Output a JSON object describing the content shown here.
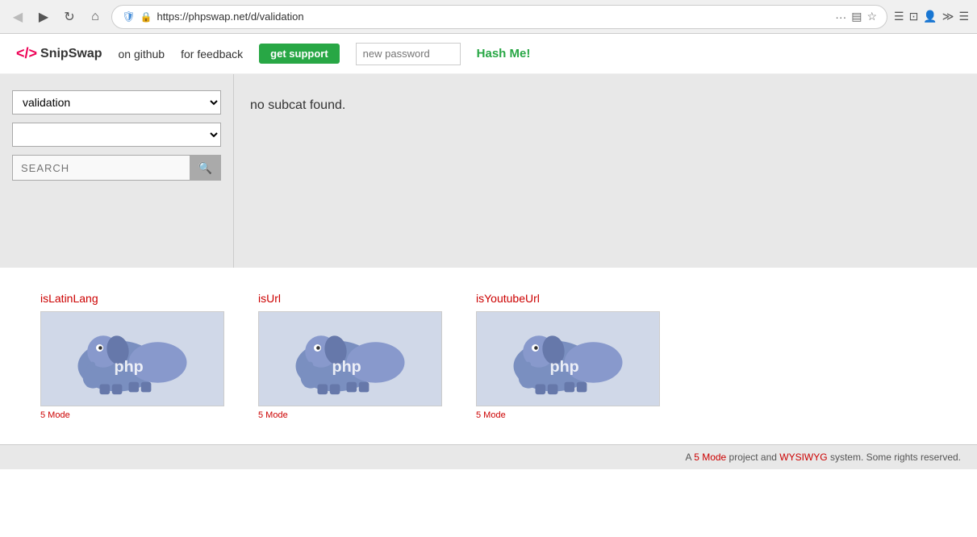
{
  "browser": {
    "url": "https://phpswap.net/d/validation",
    "back_btn": "◀",
    "forward_btn": "▶",
    "reload_btn": "↺",
    "home_btn": "⌂",
    "more_btn": "···",
    "bookmark_icon": "☆",
    "library_icon": "📚",
    "tab_icon": "⊡",
    "profile_icon": "👤",
    "overflow_icon": "≫",
    "menu_icon": "☰"
  },
  "header": {
    "logo_icon": "</>",
    "logo_name": "SnipSwap",
    "nav_github": "on github",
    "nav_feedback": "for feedback",
    "get_support": "get support",
    "password_placeholder": "new password",
    "hash_me": "Hash Me!"
  },
  "sidebar": {
    "category_selected": "validation",
    "subcat_placeholder": "",
    "search_placeholder": "SEARCH"
  },
  "content": {
    "no_subcat_message": "no subcat found."
  },
  "snippets": [
    {
      "title": "isLatinLang",
      "mode_label": "5 Mode"
    },
    {
      "title": "isUrl",
      "mode_label": "5 Mode"
    },
    {
      "title": "isYoutubeUrl",
      "mode_label": "5 Mode"
    }
  ],
  "footer": {
    "text_prefix": "A",
    "mode_link": "5 Mode",
    "text_middle": "project and",
    "wysiwyg_link": "WYSIWYG",
    "text_suffix": "system. Some rights reserved."
  }
}
